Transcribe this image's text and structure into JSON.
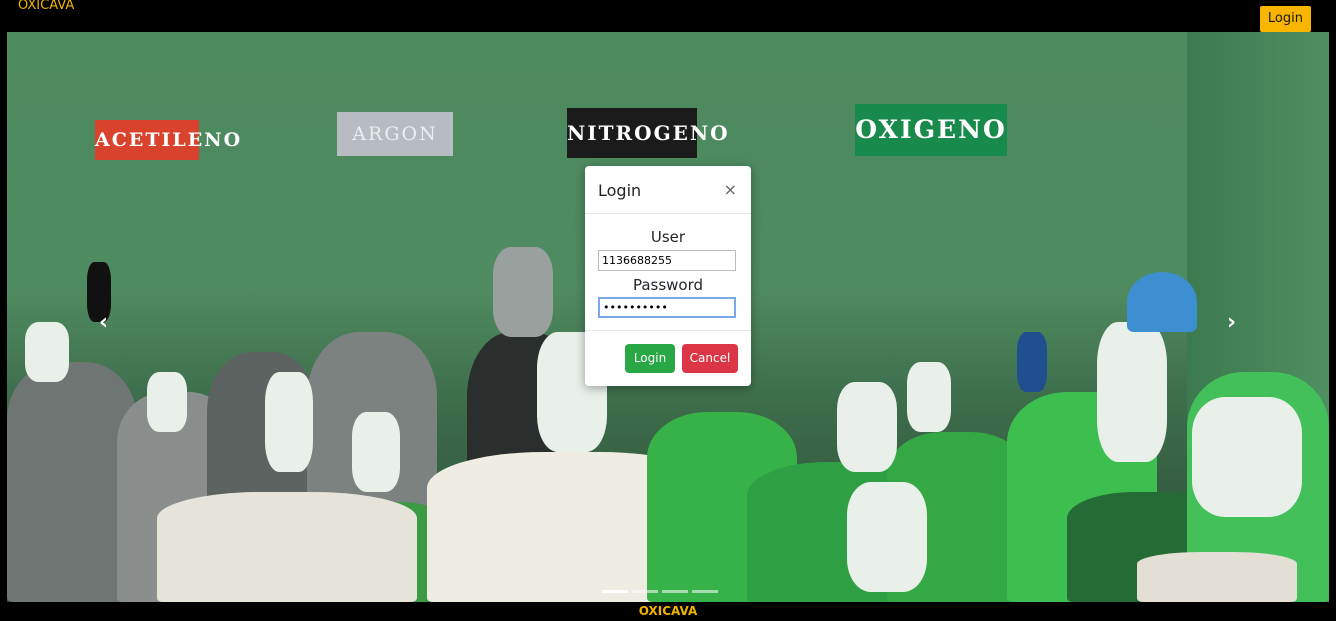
{
  "header": {
    "brand": "OXICAVA",
    "login_label": "Login"
  },
  "hero": {
    "signs": [
      "ACETILENO",
      "ARGON",
      "NITROGENO",
      "OXIGENO"
    ],
    "prev_icon": "chevron-left-icon",
    "next_icon": "chevron-right-icon",
    "slides": 4,
    "active_slide": 1
  },
  "modal": {
    "title": "Login",
    "close_glyph": "×",
    "user_label": "User",
    "user_value": "1136688255",
    "password_label": "Password",
    "password_value": "••••••••••",
    "login_button": "Login",
    "cancel_button": "Cancel"
  },
  "footer": {
    "text": "OXICAVA"
  },
  "colors": {
    "accent": "#f7b500",
    "ok": "#28a745",
    "cancel": "#dc3545"
  }
}
